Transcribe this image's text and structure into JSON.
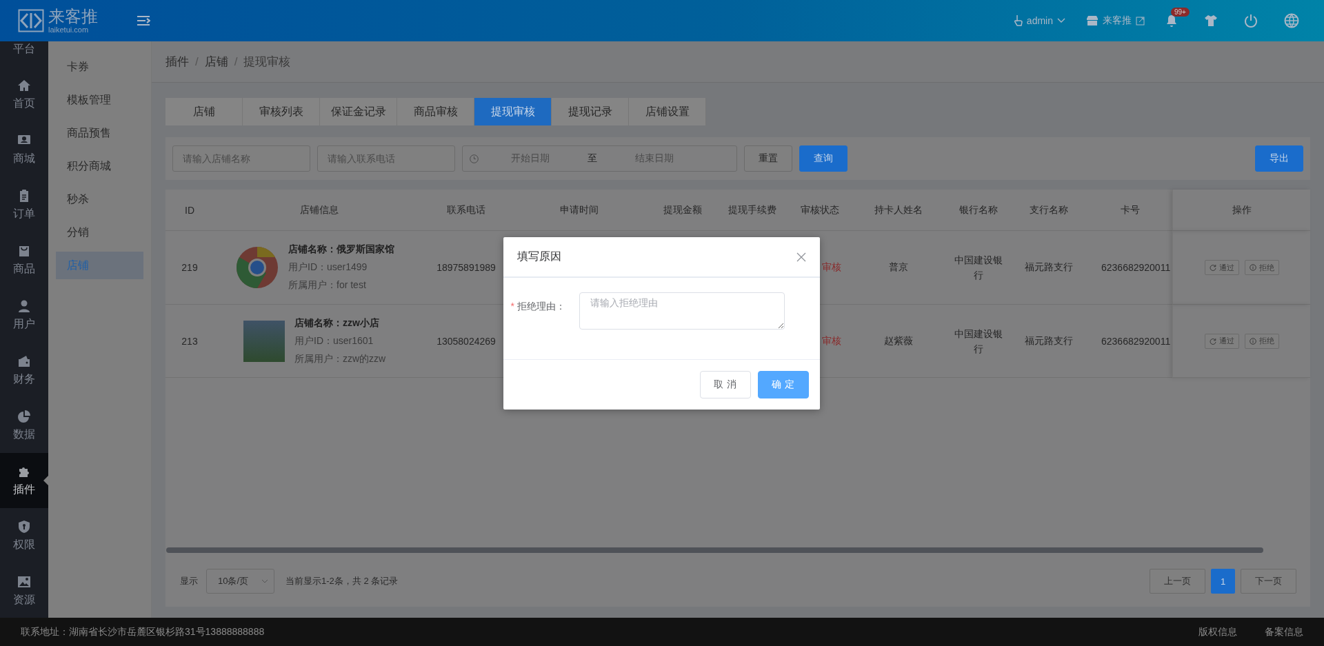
{
  "header": {
    "logo_text": "来客推",
    "logo_subtext": "laiketui.com",
    "user": "admin",
    "store_link": "来客推",
    "notification_badge": "99+"
  },
  "sidebar": {
    "items": [
      {
        "label": "平台",
        "selected": false
      },
      {
        "label": "首页",
        "selected": false
      },
      {
        "label": "商城",
        "selected": false
      },
      {
        "label": "订单",
        "selected": false
      },
      {
        "label": "商品",
        "selected": false
      },
      {
        "label": "用户",
        "selected": false
      },
      {
        "label": "财务",
        "selected": false
      },
      {
        "label": "数据",
        "selected": false
      },
      {
        "label": "插件",
        "selected": true
      },
      {
        "label": "权限",
        "selected": false
      },
      {
        "label": "资源",
        "selected": false
      }
    ]
  },
  "submenu": {
    "items": [
      {
        "label": "卡券",
        "selected": false
      },
      {
        "label": "模板管理",
        "selected": false
      },
      {
        "label": "商品预售",
        "selected": false
      },
      {
        "label": "积分商城",
        "selected": false
      },
      {
        "label": "秒杀",
        "selected": false
      },
      {
        "label": "分销",
        "selected": false
      },
      {
        "label": "店铺",
        "selected": true
      }
    ]
  },
  "breadcrumb": [
    "插件",
    "店铺",
    "提现审核"
  ],
  "breadcrumb_separator": "/",
  "tabs": [
    {
      "label": "店铺",
      "selected": false
    },
    {
      "label": "审核列表",
      "selected": false
    },
    {
      "label": "保证金记录",
      "selected": false
    },
    {
      "label": "商品审核",
      "selected": false
    },
    {
      "label": "提现审核",
      "selected": true
    },
    {
      "label": "提现记录",
      "selected": false
    },
    {
      "label": "店铺设置",
      "selected": false
    }
  ],
  "filters": {
    "store_name": {
      "placeholder": "请输入店铺名称"
    },
    "phone": {
      "placeholder": "请输入联系电话"
    },
    "date_range": {
      "start_placeholder": "开始日期",
      "separator": "至",
      "end_placeholder": "结束日期"
    },
    "reset_button": "重置",
    "query_button": "查询",
    "export_button": "导出"
  },
  "table": {
    "columns": [
      "ID",
      "店铺信息",
      "联系电话",
      "申请时间",
      "提现金额",
      "提现手续费",
      "审核状态",
      "持卡人姓名",
      "银行名称",
      "支行名称",
      "卡号",
      "操作"
    ],
    "rows": [
      {
        "id": "219",
        "store_name": "店铺名称：俄罗斯国家馆",
        "user_id": "用户ID：user1499",
        "owner": "所属用户：for test",
        "phone": "18975891989",
        "status": "审核",
        "cardholder": "普京",
        "bank": "中国建设银行",
        "branch": "福元路支行",
        "card_number": "6236682920011",
        "actions": [
          "通过",
          "拒绝"
        ]
      },
      {
        "id": "213",
        "store_name": "店铺名称：zzw小店",
        "user_id": "用户ID：user1601",
        "owner": "所属用户：zzw的zzw",
        "phone": "13058024269",
        "status": "审核",
        "cardholder": "赵紫薇",
        "bank": "中国建设银行",
        "branch": "福元路支行",
        "card_number": "6236682920011",
        "actions": [
          "通过",
          "拒绝"
        ]
      }
    ]
  },
  "pagination": {
    "show_label": "显示",
    "page_size": "10条/页",
    "summary": "当前显示1-2条，共 2 条记录",
    "prev": "上一页",
    "pages": [
      {
        "label": "1",
        "selected": true
      }
    ],
    "next": "下一页"
  },
  "footer": {
    "address": "联系地址：湖南省长沙市岳麓区银杉路31号13888888888",
    "links": [
      "版权信息",
      "备案信息"
    ]
  },
  "dialog": {
    "title": "填写原因",
    "field": {
      "required_mark": "*",
      "label": "拒绝理由：",
      "placeholder": "请输入拒绝理由"
    },
    "buttons": [
      {
        "label": "取 消",
        "kind": "cancel"
      },
      {
        "label": "确 定",
        "kind": "confirm"
      }
    ]
  }
}
